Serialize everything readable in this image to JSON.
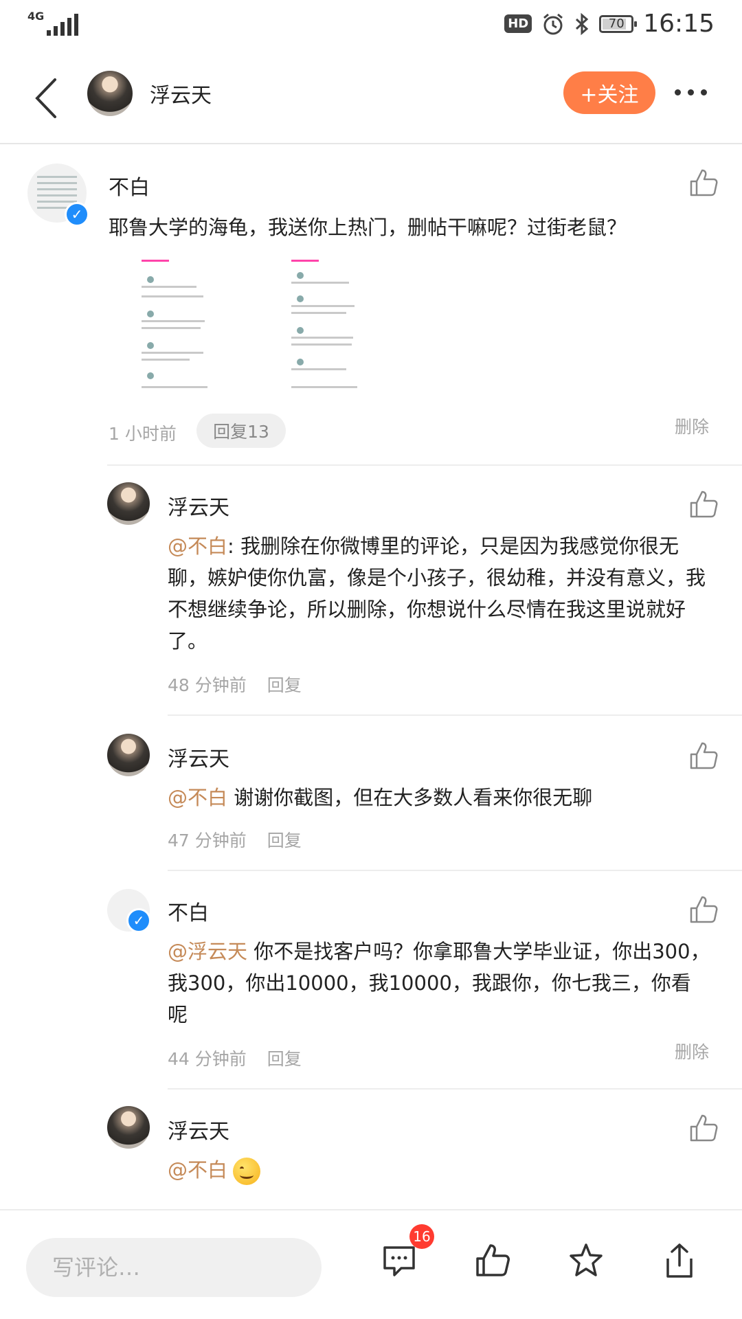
{
  "status_bar": {
    "network": "4G",
    "hd_label": "HD",
    "battery": "70",
    "time": "16:15"
  },
  "header": {
    "title": "浮云天",
    "follow_label": "+关注"
  },
  "main_comment": {
    "author": "不白",
    "text": "耶鲁大学的海龟，我送你上热门，删帖干嘛呢？过街老鼠？",
    "time": "1 小时前",
    "reply_count_label": "回复13",
    "delete_label": "删除"
  },
  "replies": [
    {
      "author": "浮云天",
      "mention": "@不白",
      "text": ": 我删除在你微博里的评论，只是因为我感觉你很无聊，嫉妒使你仇富，像是个小孩子，很幼稚，并没有意义，我不想继续争论，所以删除，你想说什么尽情在我这里说就好了。",
      "time": "48 分钟前",
      "reply_label": "回复"
    },
    {
      "author": "浮云天",
      "mention": "@不白",
      "text": " 谢谢你截图，但在大多数人看来你很无聊",
      "time": "47 分钟前",
      "reply_label": "回复"
    },
    {
      "author": "不白",
      "mention": "@浮云天",
      "text": " 你不是找客户吗？你拿耶鲁大学毕业证，你出300，我300，你出10000，我10000，我跟你，你七我三，你看呢",
      "time": "44 分钟前",
      "reply_label": "回复",
      "delete_label": "删除"
    },
    {
      "author": "浮云天",
      "mention": "@不白",
      "text": ""
    }
  ],
  "bottom_bar": {
    "input_placeholder": "写评论…",
    "comment_badge": "16"
  },
  "colors": {
    "accent": "#ff7e47",
    "mention": "#c58a58",
    "badge": "#ff3b30",
    "verified": "#1f8dfb"
  }
}
